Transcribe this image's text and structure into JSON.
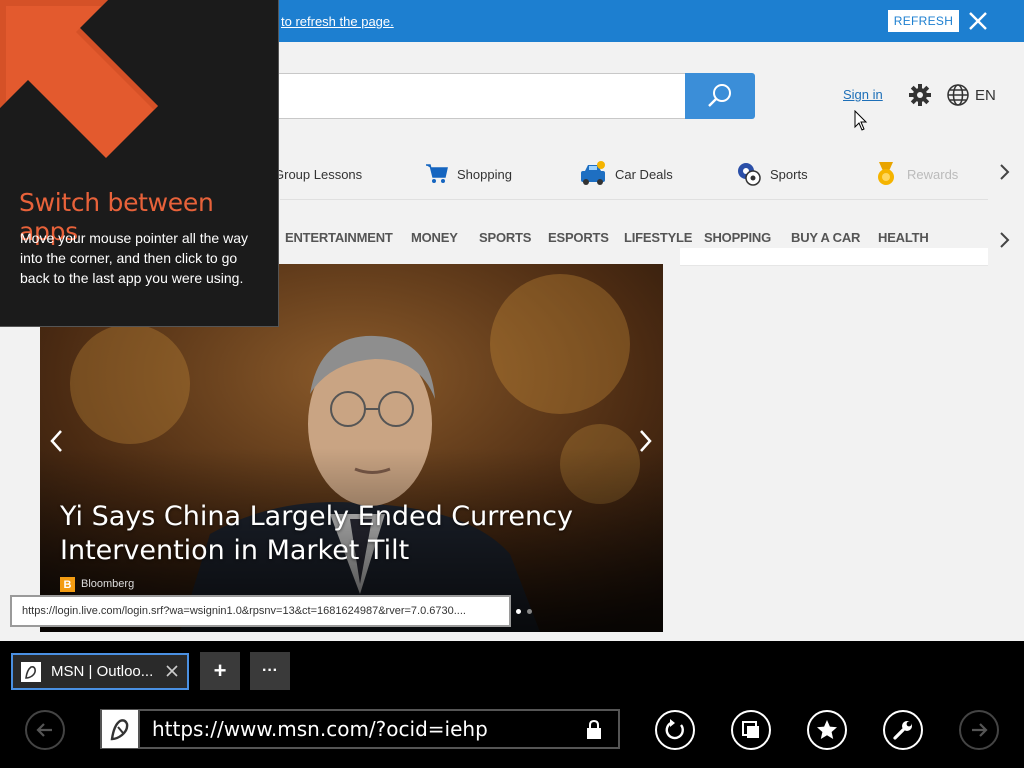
{
  "notification": {
    "text": "to refresh the page.",
    "refresh_label": "REFRESH"
  },
  "header": {
    "signin_label": "Sign in",
    "language": "EN"
  },
  "quicklinks": [
    {
      "label": "Group Lessons"
    },
    {
      "label": "Shopping"
    },
    {
      "label": "Car Deals"
    },
    {
      "label": "Sports"
    },
    {
      "label": "Rewards"
    }
  ],
  "nav": [
    "ENTERTAINMENT",
    "MONEY",
    "SPORTS",
    "ESPORTS",
    "LIFESTYLE",
    "SHOPPING",
    "BUY A CAR",
    "HEALTH"
  ],
  "hero": {
    "title": "Yi Says China Largely Ended Currency Intervention in Market Tilt",
    "source": "Bloomberg",
    "source_initial": "B"
  },
  "tooltip": {
    "url": "https://login.live.com/login.srf?wa=wsignin1.0&rpsnv=13&ct=1681624987&rver=7.0.6730...."
  },
  "switch_overlay": {
    "title": "Switch between apps",
    "body": "Move your mouse pointer all the way into the corner, and then click to go back to the last app you were using."
  },
  "browser": {
    "tab_title": "MSN | Outloo...",
    "new_tab_label": "+",
    "more_label": "···",
    "address": "https://www.msn.com/?ocid=iehp"
  },
  "colors": {
    "notification_bg": "#1d7fd0",
    "accent_orange": "#e8623a",
    "search_blue": "#3b8ed8",
    "tab_border": "#4a90e2"
  }
}
